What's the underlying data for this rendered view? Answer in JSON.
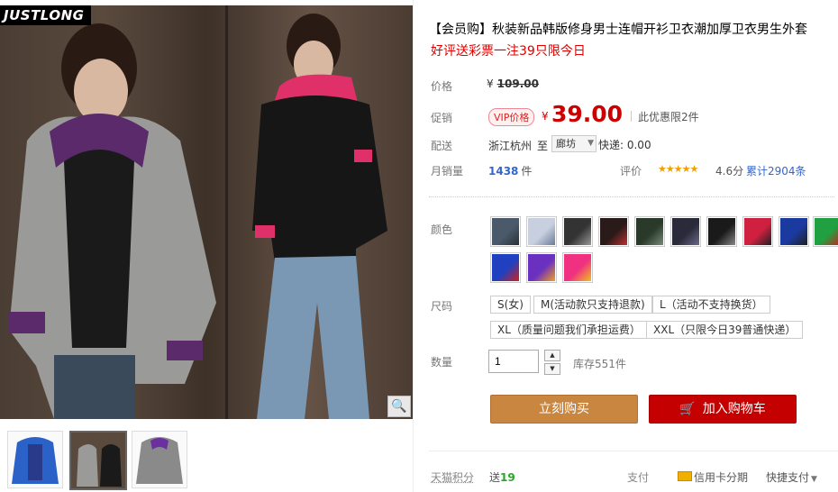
{
  "gallery": {
    "logo": "JUSTLONG",
    "magnify_icon": "magnifier-icon",
    "thumb_colors": [
      "#2a62c8",
      "#3a2a22",
      "#8a8a8a"
    ]
  },
  "product": {
    "title": "【会员购】秋装新品韩版修身男士连帽开衫卫衣潮加厚卫衣男生外套",
    "subtitle": "好评送彩票一注39只限今日"
  },
  "price": {
    "label": "价格",
    "currency": "¥",
    "original": "109.00"
  },
  "promo": {
    "label": "促销",
    "badge": "VIP价格",
    "currency": "¥",
    "value": "39.00",
    "note": "此优惠限2件"
  },
  "shipping": {
    "label": "配送",
    "from": "浙江杭州",
    "to_label": "至",
    "destination": "廊坊",
    "fee": "快递: 0.00"
  },
  "sales": {
    "label": "月销量",
    "count": "1438",
    "unit": "件",
    "rating_label": "评价",
    "stars": "★★★★★",
    "score": "4.6分",
    "reviews": "累计2904条"
  },
  "color": {
    "label": "颜色",
    "swatches": [
      {
        "name": "color-1",
        "c1": "#4a5a6a",
        "c2": "#2a3038"
      },
      {
        "name": "color-2",
        "c1": "#c8d0e0",
        "c2": "#6a7a9a"
      },
      {
        "name": "color-3",
        "c1": "#333333",
        "c2": "#999999"
      },
      {
        "name": "color-4",
        "c1": "#2a1a1a",
        "c2": "#c03030"
      },
      {
        "name": "color-5",
        "c1": "#2a3a2a",
        "c2": "#7a8a7a"
      },
      {
        "name": "color-6",
        "c1": "#2a2a3a",
        "c2": "#6a6a8a"
      },
      {
        "name": "color-7",
        "c1": "#1a1a1a",
        "c2": "#888888"
      },
      {
        "name": "color-8",
        "c1": "#d02040",
        "c2": "#202020"
      },
      {
        "name": "color-9",
        "c1": "#1a3aa0",
        "c2": "#202020"
      },
      {
        "name": "color-10",
        "c1": "#20a040",
        "c2": "#cc2020"
      },
      {
        "name": "color-11",
        "c1": "#2040c0",
        "c2": "#d02020"
      },
      {
        "name": "color-12",
        "c1": "#6a30c0",
        "c2": "#f0a020"
      },
      {
        "name": "color-13",
        "c1": "#f03080",
        "c2": "#f0c020"
      }
    ]
  },
  "size": {
    "label": "尺码",
    "options": [
      "S(女)",
      "M(活动款只支持退款)",
      "L（活动不支持换货）",
      "XL（质量问题我们承担运费）",
      "XXL（只限今日39普通快递）"
    ]
  },
  "quantity": {
    "label": "数量",
    "value": "1",
    "up_icon": "▲",
    "down_icon": "▼",
    "stock": "库存551件"
  },
  "actions": {
    "buy_now": "立刻购买",
    "add_to_cart": "加入购物车",
    "cart_icon": "🛒"
  },
  "footer": {
    "points_label": "天猫积分",
    "points_prefix": "送",
    "points_value": "19",
    "pay_label": "支付",
    "credit": "信用卡分期",
    "quick_pay": "快捷支付"
  }
}
